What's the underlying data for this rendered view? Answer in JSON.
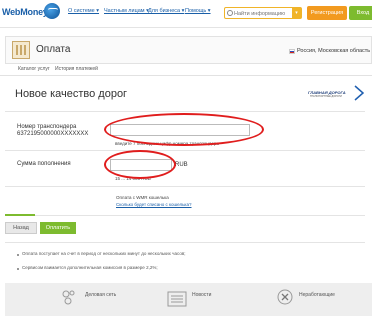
{
  "topbar": {
    "logo": "WebMoney",
    "nav": [
      "О системе ▾",
      "Частным лицам ▾",
      "Для бизнеса ▾",
      "Помощь ▾"
    ],
    "search_placeholder": "Найти информацию",
    "register_label": "Регистрация",
    "login_label": "Вход"
  },
  "header": {
    "title": "Оплата",
    "region": "Россия, Московская область",
    "tabs": [
      "Каталог услуг",
      "История платежей"
    ]
  },
  "main": {
    "title": "Новое качество дорог",
    "brand_name": "ГЛАВНАЯ ДОРОГА",
    "brand_sub": "ТРАНСПОРТНЫЕ ДОРОГИ"
  },
  "form": {
    "transponder_label_1": "Номер транспондера",
    "transponder_label_2": "6372195000000XXXXXXX",
    "transponder_hint": "введите 7 последних цифр номера транспондера",
    "amount_label": "Сумма пополнения",
    "currency": "RUB",
    "amount_hint": "15 ... 14 005 RUB",
    "wallet_label": "Оплата с WMR кошелька",
    "wallet_link": "Сколько будет списано с кошелька?"
  },
  "actions": {
    "back_label": "Назад",
    "pay_label": "Оплатить"
  },
  "notes": [
    "Оплата поступает на счет в период от нескольких минут до нескольких часов;",
    "Сервисом взимается дополнительная комиссия в размере 2,2%;"
  ],
  "footer": {
    "items": [
      "Деловая сеть",
      "Новости",
      "Неработающие"
    ]
  },
  "colors": {
    "brand_blue": "#1a5fa8",
    "orange": "#f29a1f",
    "green": "#7dbb2f",
    "annotation_red": "#e01d1d"
  }
}
